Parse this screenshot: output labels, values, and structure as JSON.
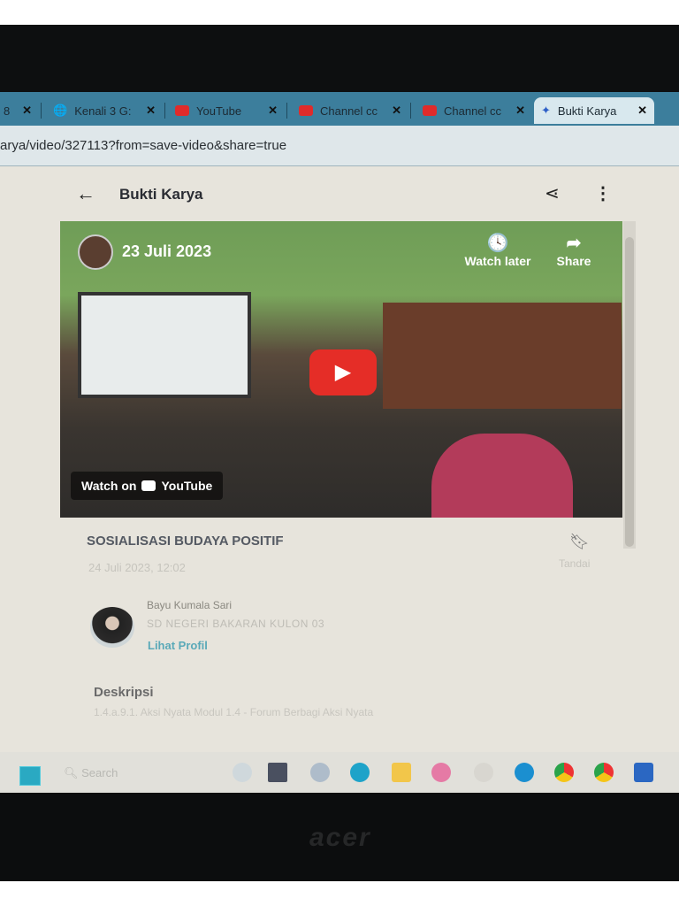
{
  "browser": {
    "tabs": [
      {
        "label": "8",
        "close": "✕"
      },
      {
        "label": "Kenali 3 G:",
        "close": "✕"
      },
      {
        "label": "YouTube",
        "close": "✕"
      },
      {
        "label": "Channel cc",
        "close": "✕"
      },
      {
        "label": "Channel cc",
        "close": "✕"
      },
      {
        "label": "Bukti Karya",
        "close": "✕"
      }
    ],
    "url": "arya/video/327113?from=save-video&share=true"
  },
  "header": {
    "title": "Bukti Karya"
  },
  "video": {
    "date": "23 Juli 2023",
    "watch_later": "Watch later",
    "share": "Share",
    "watch_on": "Watch on",
    "youtube": "YouTube"
  },
  "post": {
    "title": "SOSIALISASI BUDAYA POSITIF",
    "datetime": "24 Juli 2023, 12:02",
    "bookmark_label": "Tandai"
  },
  "author": {
    "name": "Bayu Kumala Sari",
    "school": "SD NEGERI BAKARAN KULON 03",
    "profile_link": "Lihat Profil"
  },
  "description": {
    "heading": "Deskripsi",
    "text": "1.4.a.9.1. Aksi Nyata Modul 1.4 - Forum Berbagi Aksi Nyata"
  },
  "taskbar": {
    "search": "Search"
  },
  "device": {
    "brand": "acer"
  }
}
